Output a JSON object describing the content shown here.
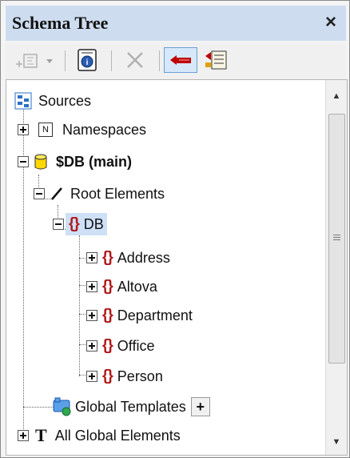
{
  "panel": {
    "title": "Schema Tree",
    "close_label": "×"
  },
  "toolbar": {
    "buttons": [
      {
        "name": "add-element-dropdown",
        "icon": "add-element-icon",
        "enabled": false
      },
      {
        "name": "show-schema-info",
        "icon": "schema-info-icon",
        "enabled": true
      },
      {
        "name": "remove",
        "icon": "delete-icon",
        "enabled": false
      },
      {
        "name": "sort-tree",
        "icon": "sort-icon",
        "enabled": true,
        "active": true
      },
      {
        "name": "list-options",
        "icon": "list-icon",
        "enabled": true
      }
    ]
  },
  "tree": {
    "sources": "Sources",
    "namespaces": "Namespaces",
    "namespaces_badge": "N",
    "db_main": "$DB (main)",
    "root_elements": "Root Elements",
    "db": "DB",
    "children": [
      "Address",
      "Altova",
      "Department",
      "Office",
      "Person"
    ],
    "global_templates": "Global Templates",
    "global_templates_add": "+",
    "all_global_elements": "All Global Elements"
  },
  "colors": {
    "titlebar": "#cddcef",
    "selection": "#cde0f6",
    "element_brace": "#b01818"
  }
}
